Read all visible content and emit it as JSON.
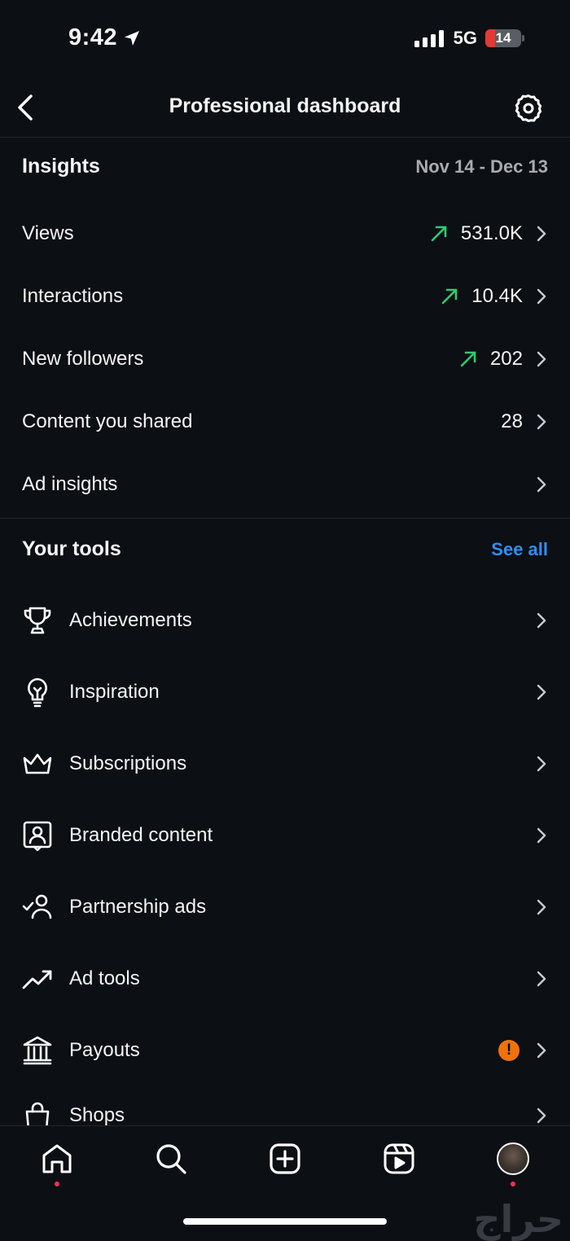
{
  "status": {
    "time": "9:42",
    "network": "5G",
    "battery": "14"
  },
  "header": {
    "title": "Professional dashboard"
  },
  "insights": {
    "title": "Insights",
    "range": "Nov 14 - Dec 13",
    "rows": [
      {
        "label": "Views",
        "value": "531.0K",
        "trend": "up"
      },
      {
        "label": "Interactions",
        "value": "10.4K",
        "trend": "up"
      },
      {
        "label": "New followers",
        "value": "202",
        "trend": "up"
      },
      {
        "label": "Content you shared",
        "value": "28"
      },
      {
        "label": "Ad insights",
        "value": ""
      }
    ]
  },
  "tools": {
    "title": "Your tools",
    "see_all": "See all",
    "items": [
      {
        "label": "Achievements",
        "icon": "trophy-icon"
      },
      {
        "label": "Inspiration",
        "icon": "lightbulb-icon"
      },
      {
        "label": "Subscriptions",
        "icon": "crown-icon"
      },
      {
        "label": "Branded content",
        "icon": "branded-content-icon"
      },
      {
        "label": "Partnership ads",
        "icon": "partnership-icon"
      },
      {
        "label": "Ad tools",
        "icon": "trending-icon"
      },
      {
        "label": "Payouts",
        "icon": "bank-icon",
        "alert": "!"
      },
      {
        "label": "Shops",
        "icon": "shopping-bag-icon"
      }
    ]
  },
  "watermark": "حراج",
  "colors": {
    "background": "#0c0f14",
    "accent": "#2f8ef5",
    "trend_up": "#2ecc71",
    "alert": "#f0720a",
    "notification": "#ff2d55"
  }
}
